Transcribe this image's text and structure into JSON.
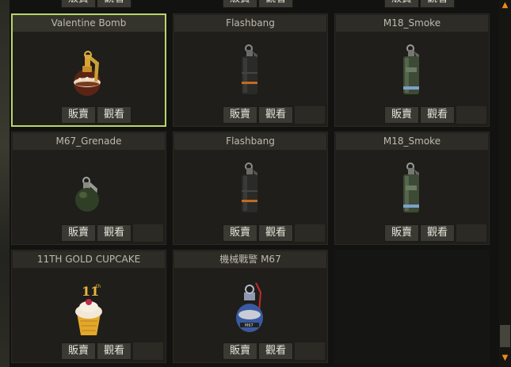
{
  "inventory": {
    "sell_label": "販賣",
    "view_label": "觀看",
    "items": [
      {
        "name": "Valentine Bomb",
        "icon": "valentine-bomb-icon",
        "selected": true
      },
      {
        "name": "Flashbang",
        "icon": "flashbang-grenade-icon",
        "selected": false
      },
      {
        "name": "M18_Smoke",
        "icon": "smoke-grenade-icon",
        "selected": false
      },
      {
        "name": "M67_Grenade",
        "icon": "frag-grenade-icon",
        "selected": false
      },
      {
        "name": "Flashbang",
        "icon": "flashbang-grenade-icon",
        "selected": false
      },
      {
        "name": "M18_Smoke",
        "icon": "smoke-grenade-icon",
        "selected": false
      },
      {
        "name": "11TH GOLD CUPCAKE",
        "icon": "gold-cupcake-icon",
        "selected": false
      },
      {
        "name": "機械戰警 M67",
        "icon": "robocop-grenade-icon",
        "selected": false
      }
    ]
  },
  "colors": {
    "selected_border": "#b8d66a",
    "scroll_arrow": "#f08a1c"
  }
}
